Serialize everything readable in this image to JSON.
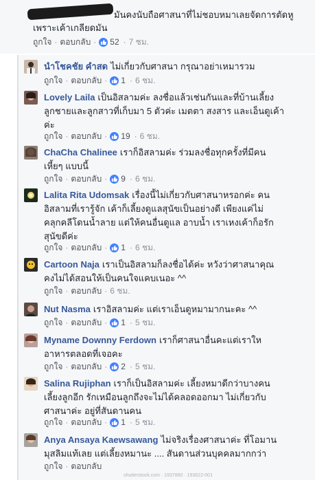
{
  "top_comment": {
    "text_line1": "มันคงนับถือศาสนาที่ไม่ชอบหมาเลยจัดการตัดหู",
    "text_line2": "เพราะเค้าเกลียดมัน",
    "like_label": "ถูกใจ",
    "reply_label": "ตอบกลับ",
    "likes": "52",
    "time": "7 ชม."
  },
  "replies": [
    {
      "name": "นำโชคชัย คำสด",
      "lines": [
        "ไม่เกี่ยวกับศาสนา กรุณาอย่าเหมารวม"
      ],
      "like_label": "ถูกใจ",
      "reply_label": "ตอบกลับ",
      "likes": "1",
      "time": "6 ชม."
    },
    {
      "name": "Lovely Laila",
      "lines": [
        "เป็นอิสลามค่ะ ลงชื่อแล้วเช่นกันและที่บ้านเลี้ยง",
        "ลูกชายและลูกสาวที่เก็บมา 5 ตัวค่ะ เมตตา สงสาร และเอ็นดูเค้า",
        "ค่ะ"
      ],
      "like_label": "ถูกใจ",
      "reply_label": "ตอบกลับ",
      "likes": "19",
      "time": "6 ชม."
    },
    {
      "name": "ChaCha Chalinee",
      "lines": [
        "เราก็อิสลามค่ะ ร่วมลงชื่อทุกครั้งที่มีคน",
        "เหี้ยๆ แบบนี้"
      ],
      "like_label": "ถูกใจ",
      "reply_label": "ตอบกลับ",
      "likes": "9",
      "time": "6 ชม."
    },
    {
      "name": "Lalita Rita Udomsak",
      "lines": [
        "เรื่องนี้ไม่เกี่ยวกับศาสนาหรอกค่ะ คน",
        "อิสลามที่เรารู้จัก เค้าก็เลี้ยงดูแลสุนัขเป็นอย่างดี เพียงแค่ไม่",
        "คลุกคลีโดนน้ำลาย แต่ให้คนอื่นดูแล อาบน้ำ เราเหงเค้าก็อรัก",
        "สุนัขดีค่ะ"
      ],
      "like_label": "ถูกใจ",
      "reply_label": "ตอบกลับ",
      "likes": "1",
      "time": "6 ชม."
    },
    {
      "name": "Cartoon Naja",
      "lines": [
        "เราเป็นอิสลามก็ลงชื่อได้ค่ะ หวังว่าศาสนาคุณ",
        "คงไม่ได้สอนให้เป็นคนใจแคบเนอะ ^^"
      ],
      "like_label": "ถูกใจ",
      "reply_label": "ตอบกลับ",
      "likes": "",
      "time": "6 ชม."
    },
    {
      "name": "Nut Nasma",
      "lines": [
        "เราอิสลามค่ะ แต่เราเอ็นดูหมามากนะคะ ^^"
      ],
      "like_label": "ถูกใจ",
      "reply_label": "ตอบกลับ",
      "likes": "1",
      "time": "5 ชม."
    },
    {
      "name": "Myname Downny Ferdown",
      "lines": [
        "เราก็ศาสนาอื่นคะแต่เราให",
        "อาหารตลอดที่เจอคะ"
      ],
      "like_label": "ถูกใจ",
      "reply_label": "ตอบกลับ",
      "likes": "2",
      "time": "5 ชม."
    },
    {
      "name": "Salina Rujiphan",
      "lines": [
        "เราก็เป็นอิสลามค่ะ เลี้ยงหมาดีกว่าบางคน",
        "เลี้ยงลูกอีก รักเหมือนลูกถึงจะไม่ได้คลอดออกมา ไม่เกี่ยวกับ",
        "ศาสนาค่ะ อยู่ที่สันดานคน"
      ],
      "like_label": "ถูกใจ",
      "reply_label": "ตอบกลับ",
      "likes": "1",
      "time": "5 ชม."
    },
    {
      "name": "Anya Ansaya Kaewsawang",
      "lines": [
        "ไม่จริงเรื่องศาสนาค่ะ ที่โอมาน",
        "มุสลิมแท้เลย แต่เลี้ยงหมานะ .... สันดานส่วนบุคคลมากกว่า"
      ],
      "like_label": "ถูกใจ",
      "reply_label": "ตอบกลับ",
      "likes": "",
      "time": ""
    }
  ],
  "footer": "shutterstock.com · 1937860 · 193622-001",
  "colors": {
    "name": "#365899",
    "like_badge": "#4080ff",
    "meta": "#90949c",
    "background": "#f6f7f9"
  }
}
